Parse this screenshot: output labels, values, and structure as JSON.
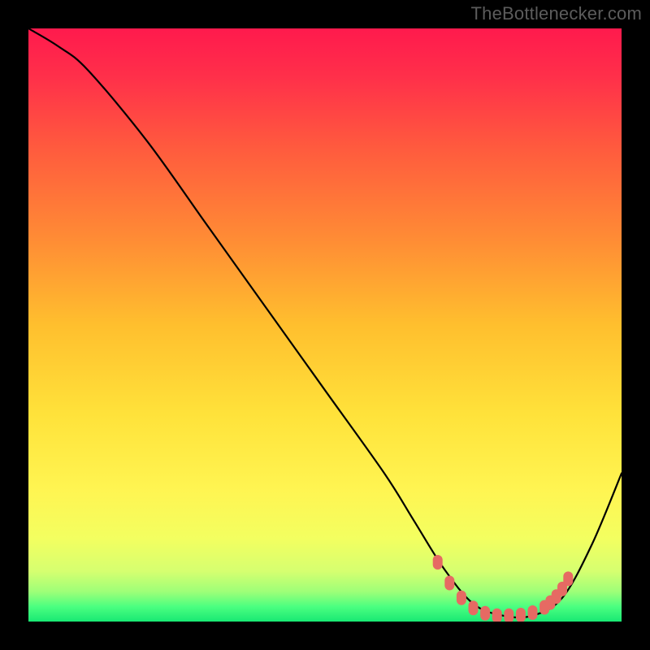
{
  "watermark": "TheBottlenecker.com",
  "chart_data": {
    "type": "line",
    "title": "",
    "xlabel": "",
    "ylabel": "",
    "xlim": [
      0,
      100
    ],
    "ylim": [
      0,
      100
    ],
    "series": [
      {
        "name": "curve",
        "x": [
          0,
          5,
          10,
          20,
          30,
          40,
          50,
          60,
          65,
          70,
          75,
          80,
          85,
          90,
          95,
          100
        ],
        "y": [
          100,
          97,
          93,
          81,
          67,
          53,
          39,
          25,
          17,
          9,
          3,
          1,
          1,
          4,
          13,
          25
        ]
      }
    ],
    "markers": {
      "name": "dots",
      "x": [
        69,
        71,
        73,
        75,
        77,
        79,
        81,
        83,
        85,
        87,
        88,
        89,
        90,
        91
      ],
      "y": [
        10.0,
        6.5,
        4.0,
        2.3,
        1.4,
        1.0,
        1.0,
        1.1,
        1.5,
        2.4,
        3.2,
        4.2,
        5.5,
        7.2
      ]
    },
    "gradient_bands": [
      {
        "stop": 0.0,
        "color": "#ff1a4d"
      },
      {
        "stop": 0.08,
        "color": "#ff2f4a"
      },
      {
        "stop": 0.2,
        "color": "#ff5a3e"
      },
      {
        "stop": 0.35,
        "color": "#ff8a35"
      },
      {
        "stop": 0.5,
        "color": "#ffbf2e"
      },
      {
        "stop": 0.65,
        "color": "#ffe23a"
      },
      {
        "stop": 0.78,
        "color": "#fff552"
      },
      {
        "stop": 0.86,
        "color": "#f3ff60"
      },
      {
        "stop": 0.915,
        "color": "#d6ff70"
      },
      {
        "stop": 0.95,
        "color": "#9dff78"
      },
      {
        "stop": 0.975,
        "color": "#4bff80"
      },
      {
        "stop": 1.0,
        "color": "#18e873"
      }
    ]
  }
}
